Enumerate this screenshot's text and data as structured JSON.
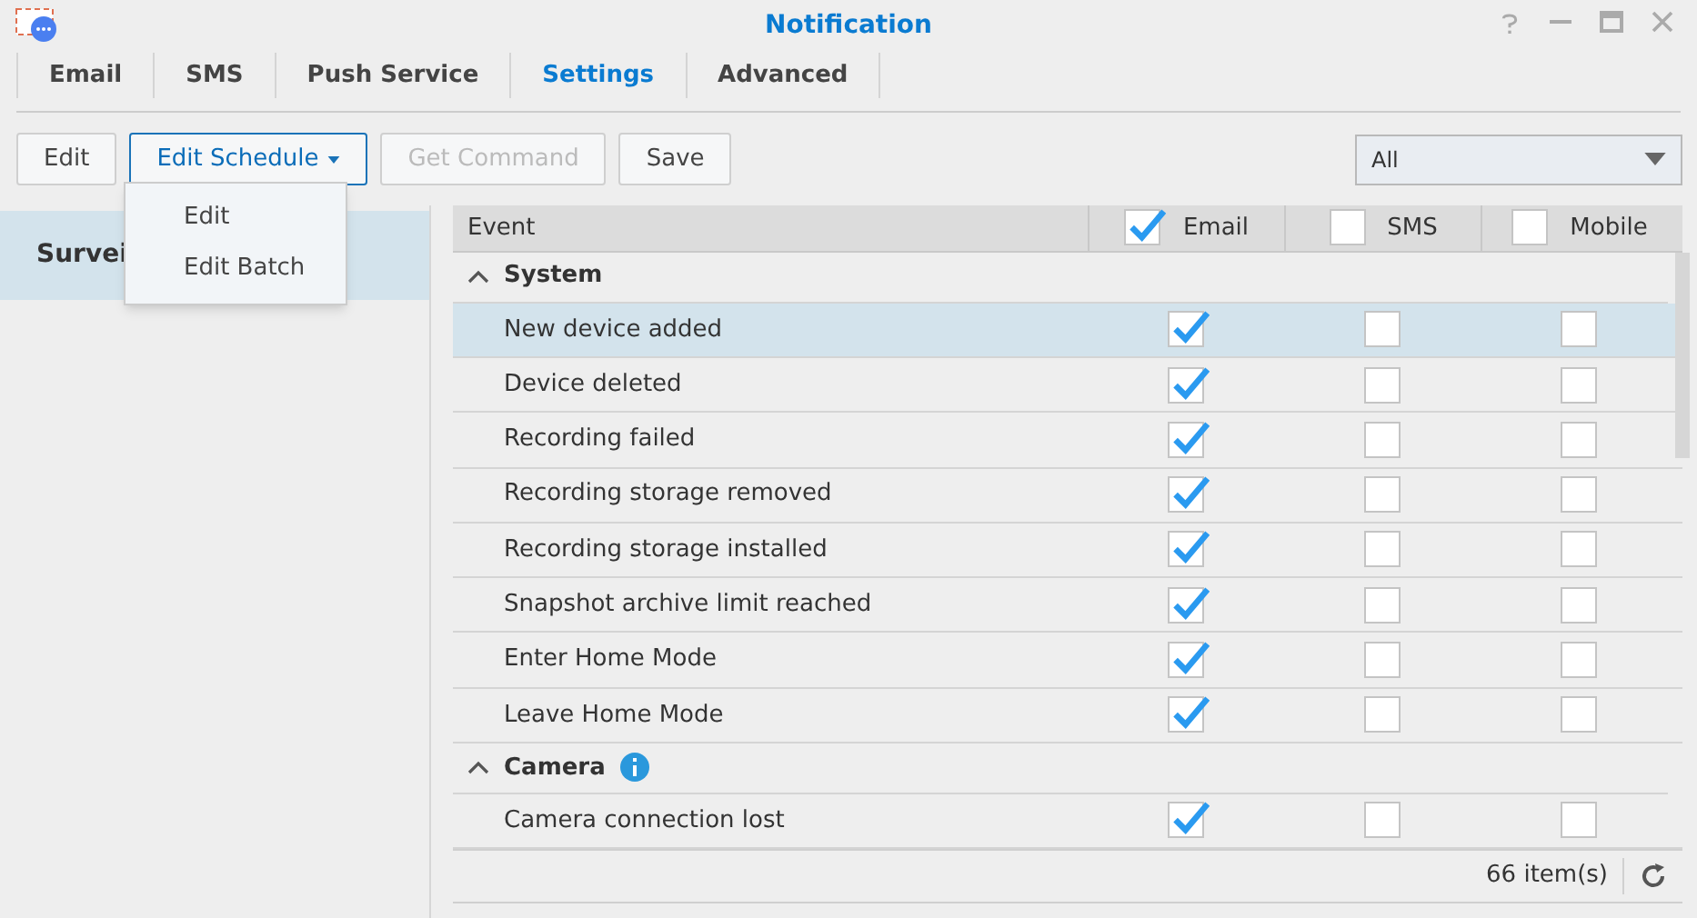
{
  "window": {
    "title": "Notification"
  },
  "tabs": [
    {
      "label": "Email",
      "selected": false
    },
    {
      "label": "SMS",
      "selected": false
    },
    {
      "label": "Push Service",
      "selected": false
    },
    {
      "label": "Settings",
      "selected": true
    },
    {
      "label": "Advanced",
      "selected": false
    }
  ],
  "toolbar": {
    "buttons": [
      {
        "label": "Edit",
        "kind": "plain",
        "disabled": false,
        "expanded": false
      },
      {
        "label": "Edit Schedule",
        "kind": "menu",
        "disabled": false,
        "expanded": true
      },
      {
        "label": "Get Command",
        "kind": "plain",
        "disabled": true,
        "expanded": false
      },
      {
        "label": "Save",
        "kind": "plain",
        "disabled": false,
        "expanded": false
      }
    ],
    "menu_items": [
      "Edit",
      "Edit Batch"
    ],
    "filter": {
      "value": "All"
    }
  },
  "sidebar": {
    "items": [
      {
        "label": "Survei",
        "selected": true
      }
    ]
  },
  "table": {
    "columns": [
      {
        "label": "Event"
      },
      {
        "label": "Email",
        "checked": true
      },
      {
        "label": "SMS",
        "checked": false
      },
      {
        "label": "Mobile",
        "checked": false
      }
    ],
    "rows": [
      {
        "kind": "group",
        "label": "System",
        "expanded": true,
        "info_icon": false
      },
      {
        "kind": "event",
        "label": "New device added",
        "selected": true,
        "email": true,
        "sms": false,
        "mobile": false
      },
      {
        "kind": "event",
        "label": "Device deleted",
        "selected": false,
        "email": true,
        "sms": false,
        "mobile": false
      },
      {
        "kind": "event",
        "label": "Recording failed",
        "selected": false,
        "email": true,
        "sms": false,
        "mobile": false
      },
      {
        "kind": "event",
        "label": "Recording storage removed",
        "selected": false,
        "email": true,
        "sms": false,
        "mobile": false
      },
      {
        "kind": "event",
        "label": "Recording storage installed",
        "selected": false,
        "email": true,
        "sms": false,
        "mobile": false
      },
      {
        "kind": "event",
        "label": "Snapshot archive limit reached",
        "selected": false,
        "email": true,
        "sms": false,
        "mobile": false
      },
      {
        "kind": "event",
        "label": "Enter Home Mode",
        "selected": false,
        "email": true,
        "sms": false,
        "mobile": false
      },
      {
        "kind": "event",
        "label": "Leave Home Mode",
        "selected": false,
        "email": true,
        "sms": false,
        "mobile": false
      },
      {
        "kind": "group",
        "label": "Camera",
        "expanded": true,
        "info_icon": true
      },
      {
        "kind": "event",
        "label": "Camera connection lost",
        "selected": false,
        "email": true,
        "sms": false,
        "mobile": false
      }
    ],
    "item_count": "66 item(s)"
  }
}
